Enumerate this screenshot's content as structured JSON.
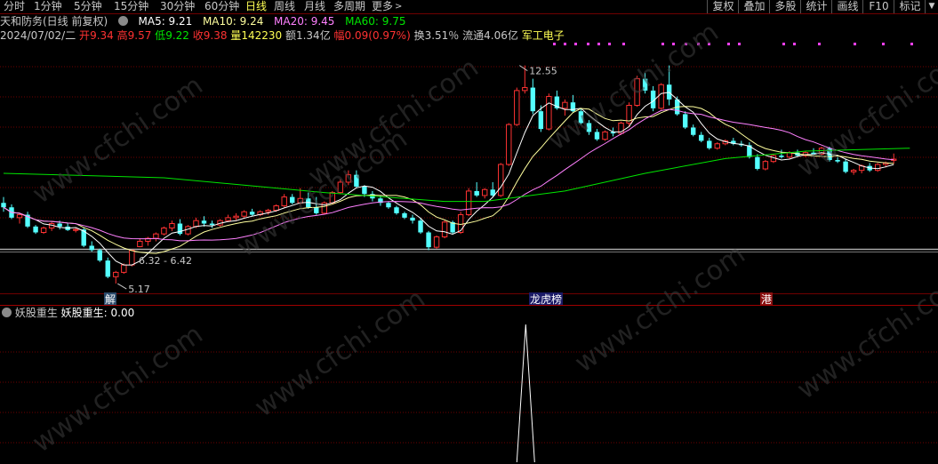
{
  "toolbar": {
    "timeframes": [
      "分时",
      "1分钟",
      "5分钟",
      "15分钟",
      "30分钟",
      "60分钟",
      "日线",
      "周线",
      "月线",
      "多周期",
      "更多"
    ],
    "active_timeframe": "日线",
    "more_chevron": ">",
    "right_buttons": [
      "复权",
      "叠加",
      "多股",
      "统计",
      "画线",
      "F10",
      "标记"
    ],
    "overflow_icon": "chevron-down-icon"
  },
  "info_line1": {
    "stock_title": "天和防务(日线 前复权)",
    "ma5": "MA5: 9.21",
    "ma10": "MA10: 9.24",
    "ma20": "MA20: 9.45",
    "ma60": "MA60: 9.75"
  },
  "info_line2": {
    "date": "2024/07/02/二",
    "open_label": "开",
    "open": "9.34",
    "high_label": "高",
    "high": "9.57",
    "low_label": "低",
    "low": "9.22",
    "close_label": "收",
    "close": "9.38",
    "volume_label": "量",
    "volume": "142230",
    "amount_label": "额",
    "amount": "1.34亿",
    "change_label": "幅",
    "change": "0.09(0.97%)",
    "turnover": "换3.51％",
    "float_cap": "流通4.06亿",
    "sector": "军工电子"
  },
  "indicator": {
    "name": "妖股重生",
    "value_text": "妖股重生: 0.00"
  },
  "markers": {
    "jie": "解",
    "longhu": "龙虎榜",
    "gang": "港"
  },
  "colors": {
    "up": "#ff3232",
    "down": "#54ffff",
    "ma5": "#ffffff",
    "ma10": "#ffff9e",
    "ma20": "#ff80ff",
    "ma60": "#00e600",
    "date": "#c8c8c8",
    "grid": "#6e0000"
  },
  "chart_data": {
    "type": "candlestick",
    "title": "天和防务(日线 前复权)",
    "annotations": [
      {
        "text": "12.55",
        "kind": "period-high"
      },
      {
        "text": "5.17",
        "kind": "period-low"
      },
      {
        "text": "6.32 - 6.42",
        "kind": "gap-range"
      }
    ],
    "price_range": [
      4.9,
      13.2
    ],
    "candles": [
      {
        "o": 7.9,
        "h": 8.1,
        "l": 7.6,
        "c": 7.75
      },
      {
        "o": 7.75,
        "h": 7.85,
        "l": 7.35,
        "c": 7.4
      },
      {
        "o": 7.4,
        "h": 7.55,
        "l": 7.2,
        "c": 7.5
      },
      {
        "o": 7.5,
        "h": 7.6,
        "l": 7.05,
        "c": 7.1
      },
      {
        "o": 7.1,
        "h": 7.15,
        "l": 6.85,
        "c": 6.9
      },
      {
        "o": 6.9,
        "h": 7.1,
        "l": 6.85,
        "c": 7.05
      },
      {
        "o": 7.05,
        "h": 7.25,
        "l": 6.95,
        "c": 7.2
      },
      {
        "o": 7.2,
        "h": 7.3,
        "l": 7.0,
        "c": 7.1
      },
      {
        "o": 7.1,
        "h": 7.2,
        "l": 6.95,
        "c": 6.98
      },
      {
        "o": 6.98,
        "h": 7.05,
        "l": 6.9,
        "c": 7.0
      },
      {
        "o": 7.0,
        "h": 7.05,
        "l": 6.4,
        "c": 6.45
      },
      {
        "o": 6.45,
        "h": 6.6,
        "l": 6.25,
        "c": 6.3
      },
      {
        "o": 6.3,
        "h": 6.35,
        "l": 5.9,
        "c": 5.95
      },
      {
        "o": 5.95,
        "h": 6.05,
        "l": 5.35,
        "c": 5.4
      },
      {
        "o": 5.4,
        "h": 5.6,
        "l": 5.17,
        "c": 5.55
      },
      {
        "o": 5.55,
        "h": 5.85,
        "l": 5.5,
        "c": 5.8
      },
      {
        "o": 5.8,
        "h": 6.3,
        "l": 5.75,
        "c": 6.3
      },
      {
        "o": 6.42,
        "h": 6.7,
        "l": 6.4,
        "c": 6.6
      },
      {
        "o": 6.6,
        "h": 6.75,
        "l": 6.45,
        "c": 6.7
      },
      {
        "o": 6.7,
        "h": 6.9,
        "l": 6.6,
        "c": 6.85
      },
      {
        "o": 6.85,
        "h": 7.1,
        "l": 6.8,
        "c": 7.05
      },
      {
        "o": 7.05,
        "h": 7.3,
        "l": 6.95,
        "c": 7.2
      },
      {
        "o": 7.2,
        "h": 7.35,
        "l": 6.8,
        "c": 6.85
      },
      {
        "o": 6.85,
        "h": 7.15,
        "l": 6.8,
        "c": 7.1
      },
      {
        "o": 7.1,
        "h": 7.4,
        "l": 7.05,
        "c": 7.3
      },
      {
        "o": 7.3,
        "h": 7.45,
        "l": 7.1,
        "c": 7.2
      },
      {
        "o": 7.2,
        "h": 7.3,
        "l": 7.05,
        "c": 7.15
      },
      {
        "o": 7.15,
        "h": 7.35,
        "l": 7.1,
        "c": 7.3
      },
      {
        "o": 7.3,
        "h": 7.5,
        "l": 7.25,
        "c": 7.4
      },
      {
        "o": 7.4,
        "h": 7.55,
        "l": 7.3,
        "c": 7.45
      },
      {
        "o": 7.45,
        "h": 7.65,
        "l": 7.4,
        "c": 7.6
      },
      {
        "o": 7.6,
        "h": 7.7,
        "l": 7.45,
        "c": 7.5
      },
      {
        "o": 7.5,
        "h": 7.65,
        "l": 7.45,
        "c": 7.6
      },
      {
        "o": 7.6,
        "h": 7.7,
        "l": 7.5,
        "c": 7.65
      },
      {
        "o": 7.65,
        "h": 7.85,
        "l": 7.6,
        "c": 7.8
      },
      {
        "o": 7.8,
        "h": 8.2,
        "l": 7.75,
        "c": 8.1
      },
      {
        "o": 8.1,
        "h": 8.2,
        "l": 7.85,
        "c": 7.9
      },
      {
        "o": 7.9,
        "h": 8.4,
        "l": 7.85,
        "c": 8.05
      },
      {
        "o": 8.05,
        "h": 8.25,
        "l": 7.7,
        "c": 7.75
      },
      {
        "o": 7.75,
        "h": 8.1,
        "l": 7.5,
        "c": 7.55
      },
      {
        "o": 7.55,
        "h": 7.95,
        "l": 7.5,
        "c": 7.9
      },
      {
        "o": 7.9,
        "h": 8.3,
        "l": 7.85,
        "c": 8.25
      },
      {
        "o": 8.25,
        "h": 8.7,
        "l": 8.2,
        "c": 8.6
      },
      {
        "o": 8.6,
        "h": 9.0,
        "l": 8.5,
        "c": 8.85
      },
      {
        "o": 8.85,
        "h": 9.0,
        "l": 8.4,
        "c": 8.45
      },
      {
        "o": 8.45,
        "h": 8.5,
        "l": 8.1,
        "c": 8.2
      },
      {
        "o": 8.2,
        "h": 8.3,
        "l": 7.95,
        "c": 8.05
      },
      {
        "o": 8.05,
        "h": 8.15,
        "l": 7.8,
        "c": 7.9
      },
      {
        "o": 7.9,
        "h": 7.95,
        "l": 7.7,
        "c": 7.75
      },
      {
        "o": 7.75,
        "h": 7.8,
        "l": 7.5,
        "c": 7.55
      },
      {
        "o": 7.55,
        "h": 7.6,
        "l": 7.35,
        "c": 7.4
      },
      {
        "o": 7.4,
        "h": 7.5,
        "l": 7.2,
        "c": 7.3
      },
      {
        "o": 7.3,
        "h": 7.4,
        "l": 6.85,
        "c": 6.9
      },
      {
        "o": 6.9,
        "h": 6.95,
        "l": 6.3,
        "c": 6.4
      },
      {
        "o": 6.4,
        "h": 6.8,
        "l": 6.35,
        "c": 6.75
      },
      {
        "o": 6.75,
        "h": 7.3,
        "l": 6.7,
        "c": 7.25
      },
      {
        "o": 7.25,
        "h": 7.3,
        "l": 6.85,
        "c": 6.9
      },
      {
        "o": 6.9,
        "h": 7.6,
        "l": 6.85,
        "c": 7.5
      },
      {
        "o": 7.5,
        "h": 8.4,
        "l": 7.45,
        "c": 8.3
      },
      {
        "o": 8.3,
        "h": 8.6,
        "l": 8.1,
        "c": 8.15
      },
      {
        "o": 8.15,
        "h": 8.4,
        "l": 8.05,
        "c": 8.35
      },
      {
        "o": 8.35,
        "h": 8.6,
        "l": 8.1,
        "c": 8.15
      },
      {
        "o": 8.15,
        "h": 9.25,
        "l": 8.1,
        "c": 9.2
      },
      {
        "o": 9.2,
        "h": 10.6,
        "l": 9.15,
        "c": 10.55
      },
      {
        "o": 10.55,
        "h": 11.8,
        "l": 10.5,
        "c": 11.7
      },
      {
        "o": 11.7,
        "h": 12.55,
        "l": 11.6,
        "c": 11.8
      },
      {
        "o": 11.8,
        "h": 12.1,
        "l": 10.9,
        "c": 11.0
      },
      {
        "o": 11.0,
        "h": 11.2,
        "l": 10.3,
        "c": 10.4
      },
      {
        "o": 10.4,
        "h": 11.6,
        "l": 10.35,
        "c": 11.5
      },
      {
        "o": 11.5,
        "h": 11.7,
        "l": 11.05,
        "c": 11.1
      },
      {
        "o": 11.1,
        "h": 11.4,
        "l": 10.85,
        "c": 11.3
      },
      {
        "o": 11.3,
        "h": 11.55,
        "l": 10.95,
        "c": 11.0
      },
      {
        "o": 11.0,
        "h": 11.1,
        "l": 10.55,
        "c": 10.6
      },
      {
        "o": 10.6,
        "h": 10.7,
        "l": 10.2,
        "c": 10.3
      },
      {
        "o": 10.3,
        "h": 10.4,
        "l": 10.0,
        "c": 10.05
      },
      {
        "o": 10.05,
        "h": 10.35,
        "l": 10.0,
        "c": 10.3
      },
      {
        "o": 10.3,
        "h": 10.45,
        "l": 10.15,
        "c": 10.25
      },
      {
        "o": 10.25,
        "h": 10.65,
        "l": 10.2,
        "c": 10.6
      },
      {
        "o": 10.6,
        "h": 11.3,
        "l": 10.5,
        "c": 11.2
      },
      {
        "o": 11.2,
        "h": 12.2,
        "l": 11.15,
        "c": 12.1
      },
      {
        "o": 12.1,
        "h": 12.3,
        "l": 11.6,
        "c": 11.7
      },
      {
        "o": 11.7,
        "h": 11.85,
        "l": 11.0,
        "c": 11.1
      },
      {
        "o": 11.1,
        "h": 11.95,
        "l": 11.05,
        "c": 11.9
      },
      {
        "o": 11.9,
        "h": 12.55,
        "l": 11.2,
        "c": 11.4
      },
      {
        "o": 11.4,
        "h": 11.5,
        "l": 10.85,
        "c": 10.9
      },
      {
        "o": 10.9,
        "h": 11.0,
        "l": 10.4,
        "c": 10.45
      },
      {
        "o": 10.45,
        "h": 10.55,
        "l": 10.15,
        "c": 10.2
      },
      {
        "o": 10.2,
        "h": 10.3,
        "l": 9.95,
        "c": 10.0
      },
      {
        "o": 10.0,
        "h": 10.1,
        "l": 9.7,
        "c": 9.75
      },
      {
        "o": 9.75,
        "h": 9.95,
        "l": 9.7,
        "c": 9.9
      },
      {
        "o": 9.9,
        "h": 10.05,
        "l": 9.85,
        "c": 10.0
      },
      {
        "o": 10.0,
        "h": 10.1,
        "l": 9.85,
        "c": 9.9
      },
      {
        "o": 9.9,
        "h": 10.0,
        "l": 9.8,
        "c": 9.85
      },
      {
        "o": 9.85,
        "h": 9.95,
        "l": 9.4,
        "c": 9.45
      },
      {
        "o": 9.45,
        "h": 9.55,
        "l": 9.0,
        "c": 9.05
      },
      {
        "o": 9.05,
        "h": 9.35,
        "l": 9.0,
        "c": 9.3
      },
      {
        "o": 9.3,
        "h": 9.55,
        "l": 9.25,
        "c": 9.5
      },
      {
        "o": 9.5,
        "h": 9.7,
        "l": 9.4,
        "c": 9.45
      },
      {
        "o": 9.45,
        "h": 9.65,
        "l": 9.4,
        "c": 9.6
      },
      {
        "o": 9.6,
        "h": 9.7,
        "l": 9.45,
        "c": 9.5
      },
      {
        "o": 9.5,
        "h": 9.65,
        "l": 9.45,
        "c": 9.6
      },
      {
        "o": 9.6,
        "h": 9.75,
        "l": 9.5,
        "c": 9.55
      },
      {
        "o": 9.55,
        "h": 9.8,
        "l": 9.5,
        "c": 9.75
      },
      {
        "o": 9.75,
        "h": 9.8,
        "l": 9.3,
        "c": 9.35
      },
      {
        "o": 9.35,
        "h": 9.45,
        "l": 9.25,
        "c": 9.3
      },
      {
        "o": 9.3,
        "h": 9.4,
        "l": 8.9,
        "c": 8.95
      },
      {
        "o": 8.95,
        "h": 9.05,
        "l": 8.85,
        "c": 9.0
      },
      {
        "o": 9.0,
        "h": 9.2,
        "l": 8.9,
        "c": 9.15
      },
      {
        "o": 9.15,
        "h": 9.25,
        "l": 8.95,
        "c": 9.0
      },
      {
        "o": 9.0,
        "h": 9.25,
        "l": 8.95,
        "c": 9.2
      },
      {
        "o": 9.2,
        "h": 9.3,
        "l": 9.1,
        "c": 9.25
      },
      {
        "o": 9.34,
        "h": 9.57,
        "l": 9.22,
        "c": 9.38
      }
    ],
    "ma60_path": [
      {
        "i": 0,
        "v": 8.9
      },
      {
        "i": 20,
        "v": 8.75
      },
      {
        "i": 40,
        "v": 8.25
      },
      {
        "i": 55,
        "v": 7.95
      },
      {
        "i": 60,
        "v": 7.95
      },
      {
        "i": 70,
        "v": 8.3
      },
      {
        "i": 80,
        "v": 8.9
      },
      {
        "i": 90,
        "v": 9.4
      },
      {
        "i": 100,
        "v": 9.65
      },
      {
        "i": 113,
        "v": 9.75
      }
    ],
    "indicator_series": {
      "name": "妖股重生",
      "signal_index": 65,
      "signal_value": 1,
      "baseline": 0
    }
  }
}
